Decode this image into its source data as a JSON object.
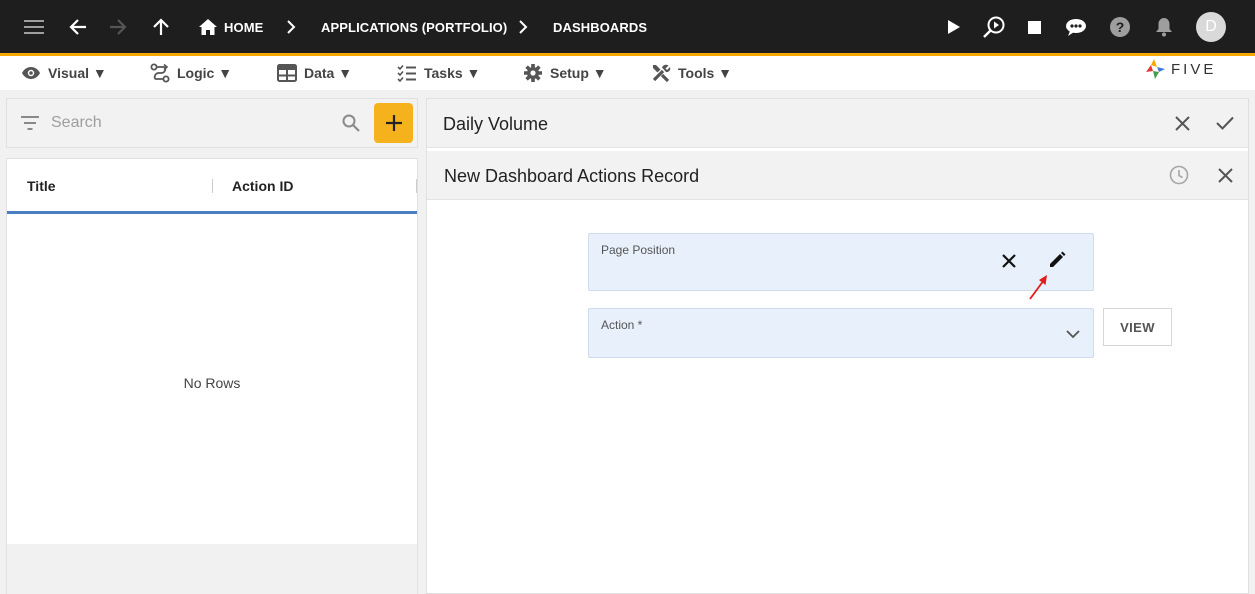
{
  "topbar": {
    "breadcrumbs": [
      "HOME",
      "APPLICATIONS (PORTFOLIO)",
      "DASHBOARDS"
    ],
    "avatar_letter": "D",
    "accent_color": "#f6a800"
  },
  "menubar": {
    "items": [
      "Visual ▼",
      "Logic ▼",
      "Data ▼",
      "Tasks ▼",
      "Setup ▼",
      "Tools ▼"
    ],
    "logo_text": "FIVE"
  },
  "left": {
    "search_placeholder": "Search",
    "columns": [
      "Title",
      "Action ID"
    ],
    "empty_text": "No Rows"
  },
  "right": {
    "outer_title": "Daily Volume",
    "form_title": "New Dashboard Actions Record",
    "fields": {
      "page_position_label": "Page Position",
      "action_label": "Action *"
    },
    "view_button": "VIEW"
  }
}
